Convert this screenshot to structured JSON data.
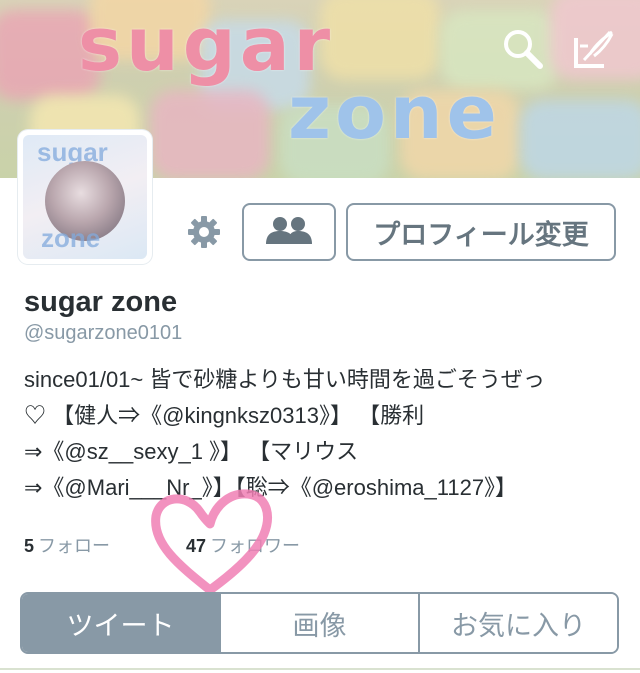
{
  "banner": {
    "title_line1": "sugar",
    "title_line2": "zone",
    "search_icon": "search-icon",
    "compose_icon": "compose-icon"
  },
  "avatar": {
    "text_top": "sugar",
    "text_bottom": "zone"
  },
  "actions": {
    "settings_icon": "gear-icon",
    "people_icon": "people-icon",
    "edit_profile_label": "プロフィール変更"
  },
  "profile": {
    "display_name": "sugar zone",
    "handle": "@sugarzone0101",
    "bio_lines": [
      "since01/01~ 皆で砂糖よりも甘い時間を過ごそうぜっ",
      "♡ 【健人⇒《@kingnksz0313》】 【勝利",
      "⇒《@sz__sexy_1 》】 【マリウス",
      "⇒《@Mari___Nr_》】【聡⇒《@eroshima_1127》】"
    ]
  },
  "stats": {
    "following_count": "5",
    "following_label": "フォロー",
    "followers_count": "47",
    "followers_label": "フォロワー"
  },
  "tabs": [
    {
      "label": "ツイート",
      "active": true
    },
    {
      "label": "画像",
      "active": false
    },
    {
      "label": "お気に入り",
      "active": false
    }
  ],
  "colors": {
    "accent": "#8899a6",
    "text": "#292f33",
    "heart": "#f07fb4"
  }
}
